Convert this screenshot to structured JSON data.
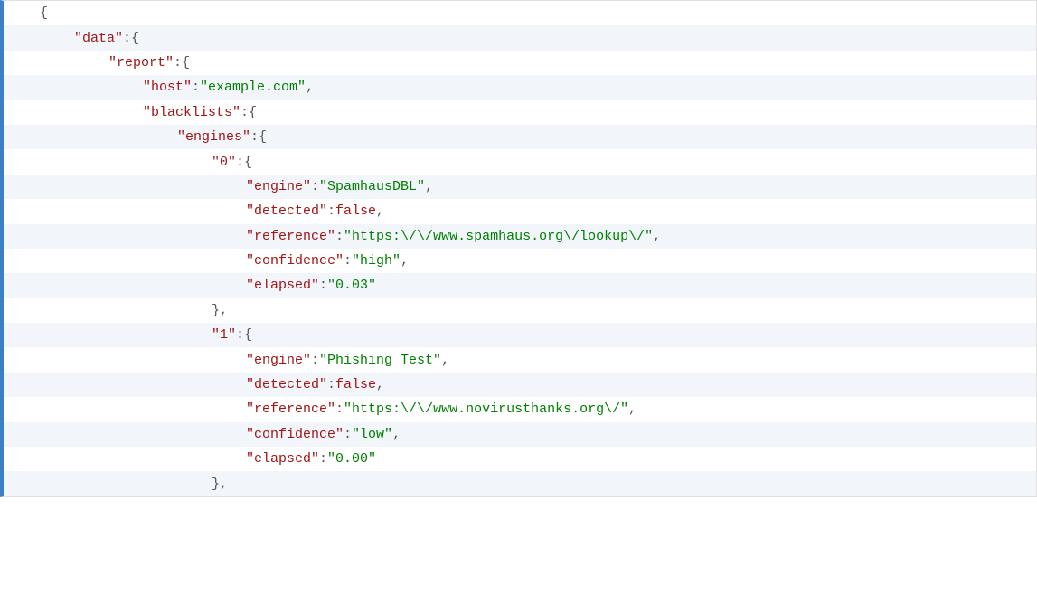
{
  "j": {
    "p_open": "{",
    "p_close": "}",
    "p_close_comma": "},",
    "p_comma": ",",
    "c_open": ":{",
    "c_str": ":",
    "data_key": "\"data\"",
    "report_key": "\"report\"",
    "host_key": "\"host\"",
    "host_val": "\"example.com\"",
    "blacklists_key": "\"blacklists\"",
    "engines_key": "\"engines\"",
    "idx0_key": "\"0\"",
    "idx1_key": "\"1\"",
    "engine_key": "\"engine\"",
    "engine0_val": "\"SpamhausDBL\"",
    "engine1_val": "\"Phishing Test\"",
    "detected_key": "\"detected\"",
    "false_kw": "false",
    "reference_key": "\"reference\"",
    "reference0_val": "\"https:\\/\\/www.spamhaus.org\\/lookup\\/\"",
    "reference1_val": "\"https:\\/\\/www.novirusthanks.org\\/\"",
    "confidence_key": "\"confidence\"",
    "confidence0_val": "\"high\"",
    "confidence1_val": "\"low\"",
    "elapsed_key": "\"elapsed\"",
    "elapsed0_val": "\"0.03\"",
    "elapsed1_val": "\"0.00\""
  }
}
